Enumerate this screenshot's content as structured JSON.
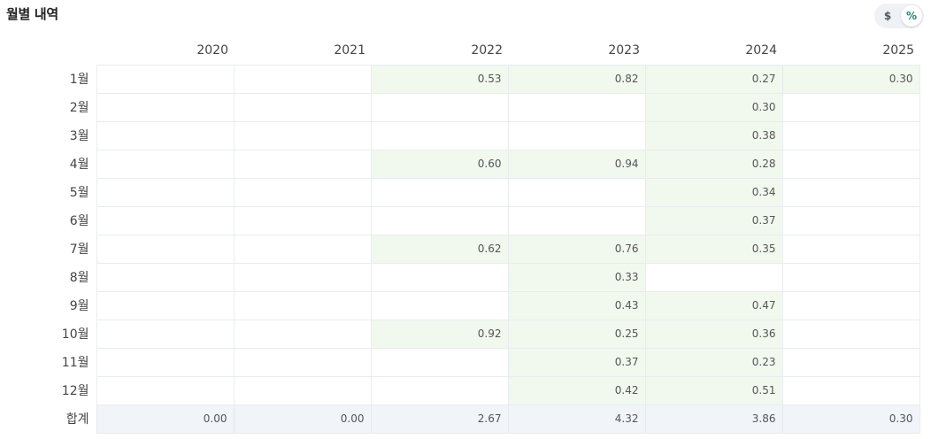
{
  "header": {
    "title": "월별 내역"
  },
  "toggle": {
    "options": [
      "$",
      "%"
    ],
    "selected": "%"
  },
  "colors": {
    "positive_cell": "#f1f8ee",
    "total_row": "#f1f4f8",
    "toggle_active": "#1a8a7a"
  },
  "table": {
    "years": [
      "2020",
      "2021",
      "2022",
      "2023",
      "2024",
      "2025"
    ],
    "rows": [
      {
        "month": "1월",
        "values": [
          "",
          "",
          "0.53",
          "0.82",
          "0.27",
          "0.30"
        ]
      },
      {
        "month": "2월",
        "values": [
          "",
          "",
          "",
          "",
          "0.30",
          ""
        ]
      },
      {
        "month": "3월",
        "values": [
          "",
          "",
          "",
          "",
          "0.38",
          ""
        ]
      },
      {
        "month": "4월",
        "values": [
          "",
          "",
          "0.60",
          "0.94",
          "0.28",
          ""
        ]
      },
      {
        "month": "5월",
        "values": [
          "",
          "",
          "",
          "",
          "0.34",
          ""
        ]
      },
      {
        "month": "6월",
        "values": [
          "",
          "",
          "",
          "",
          "0.37",
          ""
        ]
      },
      {
        "month": "7월",
        "values": [
          "",
          "",
          "0.62",
          "0.76",
          "0.35",
          ""
        ]
      },
      {
        "month": "8월",
        "values": [
          "",
          "",
          "",
          "0.33",
          "",
          ""
        ]
      },
      {
        "month": "9월",
        "values": [
          "",
          "",
          "",
          "0.43",
          "0.47",
          ""
        ]
      },
      {
        "month": "10월",
        "values": [
          "",
          "",
          "0.92",
          "0.25",
          "0.36",
          ""
        ]
      },
      {
        "month": "11월",
        "values": [
          "",
          "",
          "",
          "0.37",
          "0.23",
          ""
        ]
      },
      {
        "month": "12월",
        "values": [
          "",
          "",
          "",
          "0.42",
          "0.51",
          ""
        ]
      }
    ],
    "total": {
      "label": "합계",
      "values": [
        "0.00",
        "0.00",
        "2.67",
        "4.32",
        "3.86",
        "0.30"
      ]
    }
  }
}
